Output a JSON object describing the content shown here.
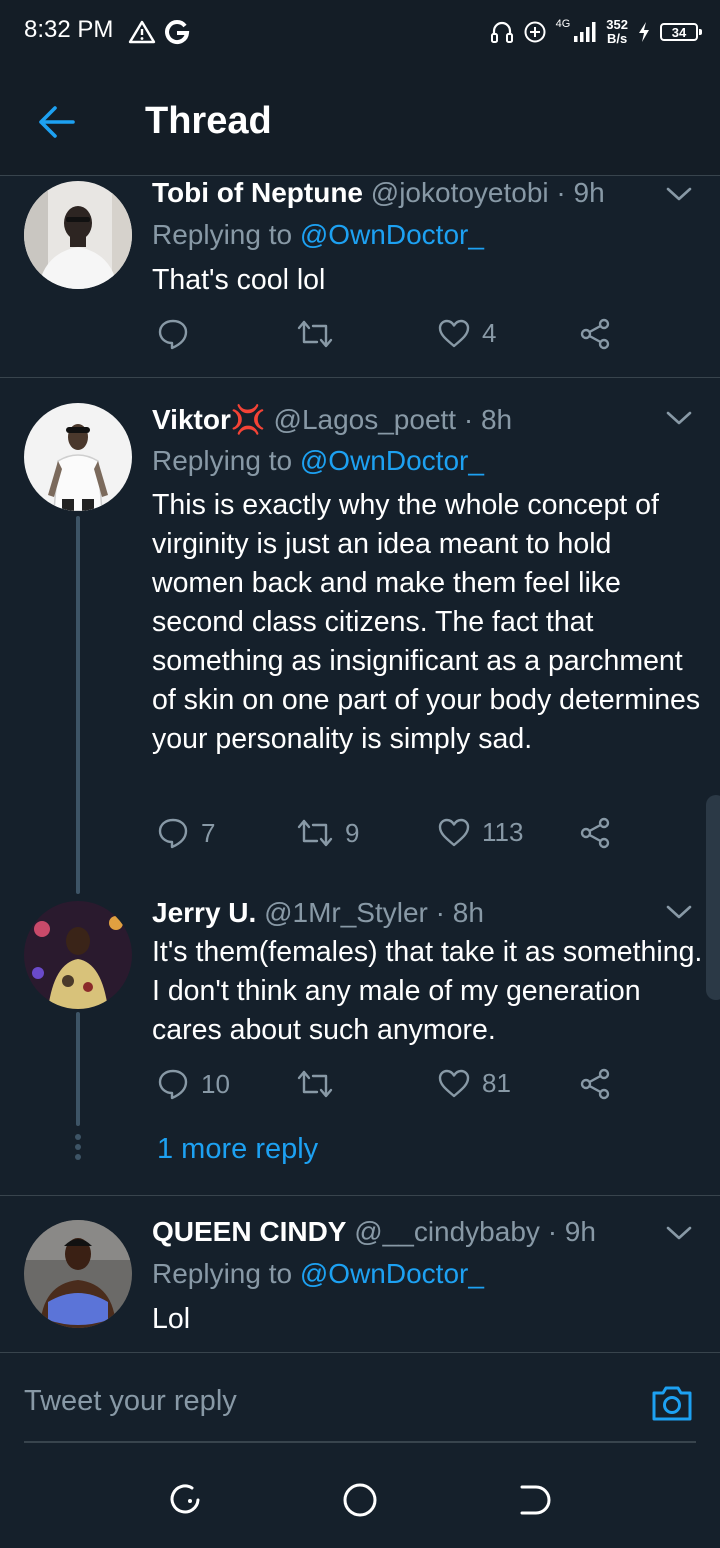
{
  "status_bar": {
    "time": "8:32 PM",
    "left_icons": [
      "alert-triangle-icon",
      "google-icon"
    ],
    "network": "4G",
    "speed_value": "352",
    "speed_unit": "B/s",
    "battery": "34"
  },
  "header": {
    "title": "Thread"
  },
  "tweets": [
    {
      "name": "Tobi of Neptune",
      "handle": "@jokotoyetobi",
      "time": "· 9h",
      "reply_prefix": "Replying to ",
      "reply_to": "@OwnDoctor_",
      "text": "That's cool lol",
      "replies": "",
      "retweets": "",
      "likes": "4"
    },
    {
      "name": "Viktor",
      "emoji": "💢",
      "handle": "@Lagos_poett",
      "time": "· 8h",
      "reply_prefix": "Replying to ",
      "reply_to": "@OwnDoctor_",
      "text": "This is exactly why the whole concept of virginity is just an idea meant to hold women back and make them feel like second class citizens. The fact that something as insignificant as a parchment of skin on one part of your body determines your personality is simply sad.",
      "replies": "7",
      "retweets": "9",
      "likes": "113"
    },
    {
      "name": "Jerry U.",
      "handle": "@1Mr_Styler",
      "time": "· 8h",
      "text": "It's them(females) that take it as something. I don't think any male of my generation cares about such anymore.",
      "replies": "10",
      "retweets": "",
      "likes": "81"
    },
    {
      "name": "QUEEN CINDY",
      "handle": "@__cindybaby",
      "time": "· 9h",
      "reply_prefix": "Replying to ",
      "reply_to": "@OwnDoctor_",
      "text": "Lol"
    }
  ],
  "more_reply": "1 more reply",
  "composer": {
    "placeholder": "Tweet your reply"
  },
  "colors": {
    "background": "#15202b",
    "accent": "#1da1f2",
    "muted": "#8899a6",
    "divider": "#38444d"
  }
}
